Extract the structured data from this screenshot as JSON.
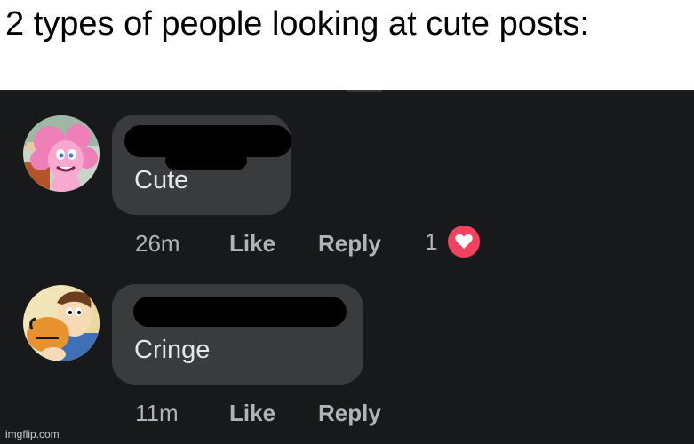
{
  "caption": {
    "text": "2 types of people looking at cute posts:"
  },
  "comments": [
    {
      "text": "Cute",
      "time": "26m",
      "like_label": "Like",
      "reply_label": "Reply",
      "reaction_count": "1",
      "reaction_icon": "heart-icon",
      "reaction_color": "#f3425f"
    },
    {
      "text": "Cringe",
      "time": "11m",
      "like_label": "Like",
      "reply_label": "Reply"
    }
  ],
  "watermark": "imgflip.com",
  "theme": {
    "background": "#18191a",
    "bubble": "#3a3b3c",
    "text": "#e4e6eb",
    "meta_text": "#b0b3b8"
  }
}
